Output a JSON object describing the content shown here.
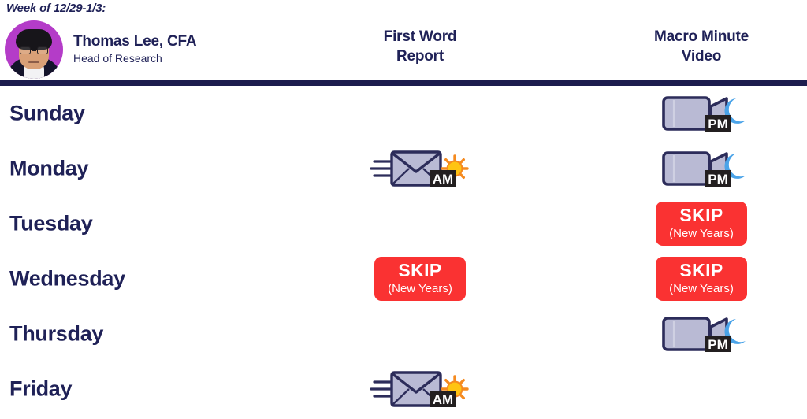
{
  "header": {
    "week_label": "Week of 12/29-1/3:",
    "person": {
      "name": "Thomas Lee, CFA",
      "title": "Head of Research",
      "avatar_alt": "avatar"
    },
    "columns": [
      {
        "line1": "First Word",
        "line2": "Report"
      },
      {
        "line1": "Macro Minute",
        "line2": "Video"
      }
    ]
  },
  "badges": {
    "skip_label": "SKIP",
    "skip_reason": "(New Years)",
    "am_label": "AM",
    "pm_label": "PM"
  },
  "colors": {
    "navy": "#1f2157",
    "divider": "#1d1d4e",
    "skip_red": "#fa3232",
    "avatar_bg": "#b43cc8",
    "sun": "#ffc412",
    "moon": "#4aa3e8",
    "icon_outline": "#2c2c5a",
    "icon_fill": "#b9bad4"
  },
  "schedule": [
    {
      "day": "Sunday",
      "first_word": "none",
      "macro_minute": "pm"
    },
    {
      "day": "Monday",
      "first_word": "am",
      "macro_minute": "pm"
    },
    {
      "day": "Tuesday",
      "first_word": "none",
      "macro_minute": "skip"
    },
    {
      "day": "Wednesday",
      "first_word": "skip",
      "macro_minute": "skip"
    },
    {
      "day": "Thursday",
      "first_word": "none",
      "macro_minute": "pm"
    },
    {
      "day": "Friday",
      "first_word": "am",
      "macro_minute": "none"
    }
  ]
}
